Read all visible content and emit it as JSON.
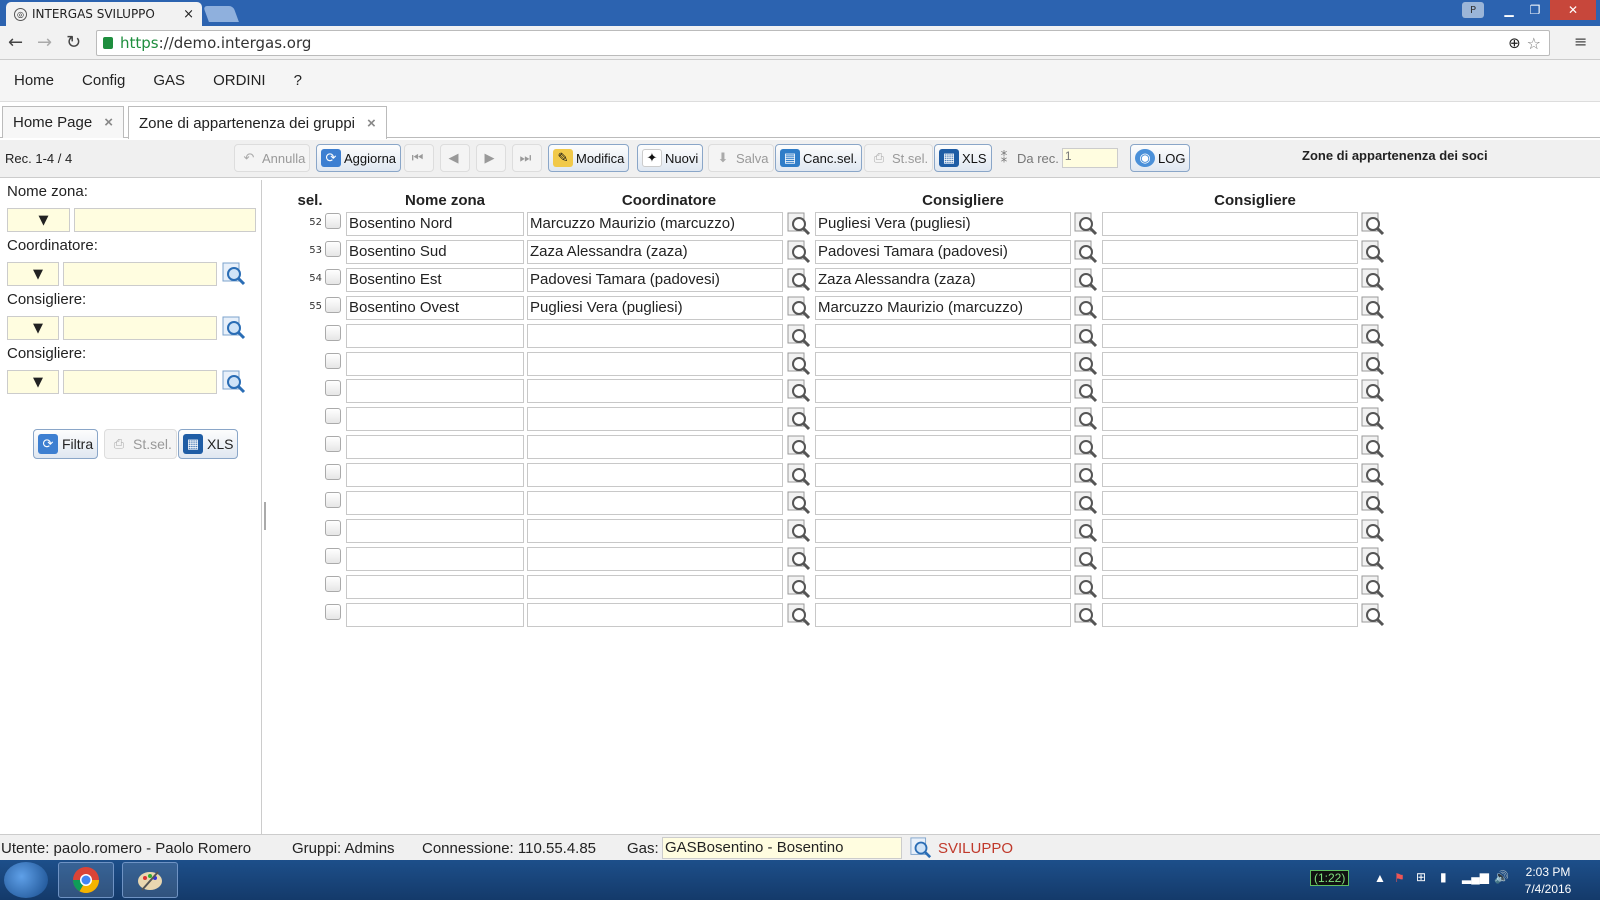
{
  "browser": {
    "tab_title": "INTERGAS SVILUPPO",
    "tab_close": "×",
    "url_scheme": "https",
    "url_rest": "://demo.intergas.org"
  },
  "menu": [
    "Home",
    "Config",
    "GAS",
    "ORDINI",
    "?"
  ],
  "tabs": [
    {
      "label": "Home Page",
      "close": "×"
    },
    {
      "label": "Zone di appartenenza dei gruppi",
      "close": "×"
    }
  ],
  "toolbar": {
    "record_info": "Rec. 1-4 / 4",
    "annulla": "Annulla",
    "aggiorna": "Aggiorna",
    "modifica": "Modifica",
    "nuovi": "Nuovi",
    "salva": "Salva",
    "canc_sel": "Canc.sel.",
    "st_sel": "St.sel.",
    "xls": "XLS",
    "da_rec": "Da rec.",
    "da_rec_value": "1",
    "log": "LOG",
    "section_title": "Zone di appartenenza dei soci"
  },
  "filters": {
    "nome_zona_label": "Nome zona:",
    "coordinatore_label": "Coordinatore:",
    "consigliere1_label": "Consigliere:",
    "consigliere2_label": "Consigliere:",
    "op_symbol": "▼",
    "filtra": "Filtra",
    "st_sel": "St.sel.",
    "xls": "XLS"
  },
  "grid": {
    "headers": {
      "sel": "sel.",
      "nome_zona": "Nome zona",
      "coordinatore": "Coordinatore",
      "consigliere1": "Consigliere",
      "consigliere2": "Consigliere"
    },
    "rows": [
      {
        "num": "52",
        "nome_zona": "Bosentino Nord",
        "coordinatore": "Marcuzzo Maurizio (marcuzzo)",
        "consigliere1": "Pugliesi Vera (pugliesi)",
        "consigliere2": ""
      },
      {
        "num": "53",
        "nome_zona": "Bosentino Sud",
        "coordinatore": "Zaza Alessandra (zaza)",
        "consigliere1": "Padovesi Tamara (padovesi)",
        "consigliere2": ""
      },
      {
        "num": "54",
        "nome_zona": "Bosentino Est",
        "coordinatore": "Padovesi Tamara (padovesi)",
        "consigliere1": "Zaza Alessandra (zaza)",
        "consigliere2": ""
      },
      {
        "num": "55",
        "nome_zona": "Bosentino Ovest",
        "coordinatore": "Pugliesi Vera (pugliesi)",
        "consigliere1": "Marcuzzo Maurizio (marcuzzo)",
        "consigliere2": ""
      },
      {
        "num": "",
        "nome_zona": "",
        "coordinatore": "",
        "consigliere1": "",
        "consigliere2": ""
      },
      {
        "num": "",
        "nome_zona": "",
        "coordinatore": "",
        "consigliere1": "",
        "consigliere2": ""
      },
      {
        "num": "",
        "nome_zona": "",
        "coordinatore": "",
        "consigliere1": "",
        "consigliere2": ""
      },
      {
        "num": "",
        "nome_zona": "",
        "coordinatore": "",
        "consigliere1": "",
        "consigliere2": ""
      },
      {
        "num": "",
        "nome_zona": "",
        "coordinatore": "",
        "consigliere1": "",
        "consigliere2": ""
      },
      {
        "num": "",
        "nome_zona": "",
        "coordinatore": "",
        "consigliere1": "",
        "consigliere2": ""
      },
      {
        "num": "",
        "nome_zona": "",
        "coordinatore": "",
        "consigliere1": "",
        "consigliere2": ""
      },
      {
        "num": "",
        "nome_zona": "",
        "coordinatore": "",
        "consigliere1": "",
        "consigliere2": ""
      },
      {
        "num": "",
        "nome_zona": "",
        "coordinatore": "",
        "consigliere1": "",
        "consigliere2": ""
      },
      {
        "num": "",
        "nome_zona": "",
        "coordinatore": "",
        "consigliere1": "",
        "consigliere2": ""
      },
      {
        "num": "",
        "nome_zona": "",
        "coordinatore": "",
        "consigliere1": "",
        "consigliere2": ""
      }
    ]
  },
  "status": {
    "utente": "Utente: paolo.romero - Paolo Romero",
    "gruppi": "Gruppi: Admins",
    "connessione": "Connessione: 110.55.4.85",
    "gas_label": "Gas:",
    "gas_value": "GASBosentino - Bosentino",
    "env": "SVILUPPO"
  },
  "taskbar": {
    "battery": "(1:22)",
    "time": "2:03 PM",
    "date": "7/4/2016"
  },
  "colors": {
    "accent_blue": "#2c63b0",
    "input_yellow": "#fffde0",
    "env_red": "#c0392b"
  }
}
